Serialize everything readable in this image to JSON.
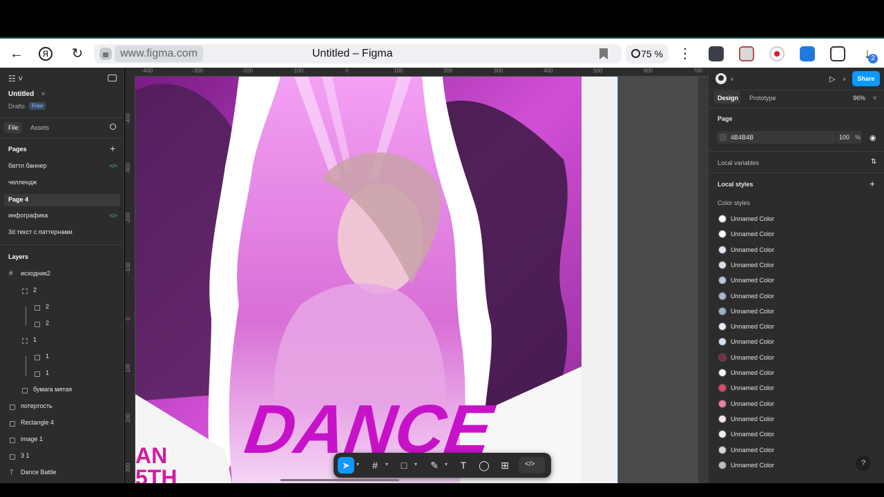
{
  "browser": {
    "url": "www.figma.com",
    "tab_title": "Untitled – Figma",
    "zoom": "75 %",
    "download_count": "2"
  },
  "left": {
    "file_name": "Untitled",
    "location": "Drafts",
    "plan_badge": "Free",
    "tabs": [
      "File",
      "Assets"
    ],
    "pages_header": "Pages",
    "pages": [
      {
        "label": "баттл баннер",
        "dev": true
      },
      {
        "label": "челлендж",
        "dev": false
      },
      {
        "label": "Page 4",
        "dev": false,
        "active": true
      },
      {
        "label": "инфографика",
        "dev": true
      },
      {
        "label": "3d текст с паттернами",
        "dev": false
      }
    ],
    "layers_header": "Layers",
    "layers": [
      {
        "label": "исходник2",
        "indent": 0
      },
      {
        "label": "2",
        "indent": 1
      },
      {
        "label": "2",
        "indent": 2
      },
      {
        "label": "2",
        "indent": 2
      },
      {
        "label": "1",
        "indent": 1
      },
      {
        "label": "1",
        "indent": 2
      },
      {
        "label": "1",
        "indent": 2
      },
      {
        "label": "бумага мятая",
        "indent": 1
      },
      {
        "label": "потертость",
        "indent": 0
      },
      {
        "label": "Rectangle 4",
        "indent": 0
      },
      {
        "label": "image 1",
        "indent": 0
      },
      {
        "label": "3 1",
        "indent": 0
      },
      {
        "label": "Dance Battle",
        "indent": 0
      }
    ],
    "dev_mark": "</>"
  },
  "ruler": {
    "top": [
      "-400",
      "-300",
      "-200",
      "-100",
      "0",
      "100",
      "200",
      "300",
      "400",
      "500",
      "600",
      "700"
    ],
    "left": [
      "-400",
      "-300",
      "-200",
      "-100",
      "0",
      "100",
      "200",
      "300"
    ]
  },
  "artboard": {
    "headline": "DANCE",
    "side_text_1": "AN",
    "side_text_2": "5TH"
  },
  "right": {
    "tabs": [
      "Design",
      "Prototype"
    ],
    "zoom": "96%",
    "share_label": "Share",
    "page_header": "Page",
    "page_fill_hex": "4B4B4B",
    "page_fill_opacity": "100",
    "percent_sign": "%",
    "local_variables": "Local variables",
    "local_styles": "Local styles",
    "color_styles_header": "Color styles",
    "color_styles": [
      {
        "label": "Unnamed Color",
        "color": "#ffffff"
      },
      {
        "label": "Unnamed Color",
        "color": "#ffffff"
      },
      {
        "label": "Unnamed Color",
        "color": "#dfe6f1"
      },
      {
        "label": "Unnamed Color",
        "color": "#d6dde7"
      },
      {
        "label": "Unnamed Color",
        "color": "#b9c7d8"
      },
      {
        "label": "Unnamed Color",
        "color": "#a9b7c7"
      },
      {
        "label": "Unnamed Color",
        "color": "#9fb0c2"
      },
      {
        "label": "Unnamed Color",
        "color": "#e7edf6"
      },
      {
        "label": "Unnamed Color",
        "color": "#cfe0f7"
      },
      {
        "label": "Unnamed Color",
        "color": "#7d2a4a"
      },
      {
        "label": "Unnamed Color",
        "color": "#f3f3f3"
      },
      {
        "label": "Unnamed Color",
        "color": "#e0456e"
      },
      {
        "label": "Unnamed Color",
        "color": "#ef7fa0"
      },
      {
        "label": "Unnamed Color",
        "color": "#f8e4ea"
      },
      {
        "label": "Unnamed Color",
        "color": "#f6eef1"
      },
      {
        "label": "Unnamed Color",
        "color": "#d7d7d7"
      },
      {
        "label": "Unnamed Color",
        "color": "#bdbdbd"
      }
    ]
  },
  "help": "?"
}
